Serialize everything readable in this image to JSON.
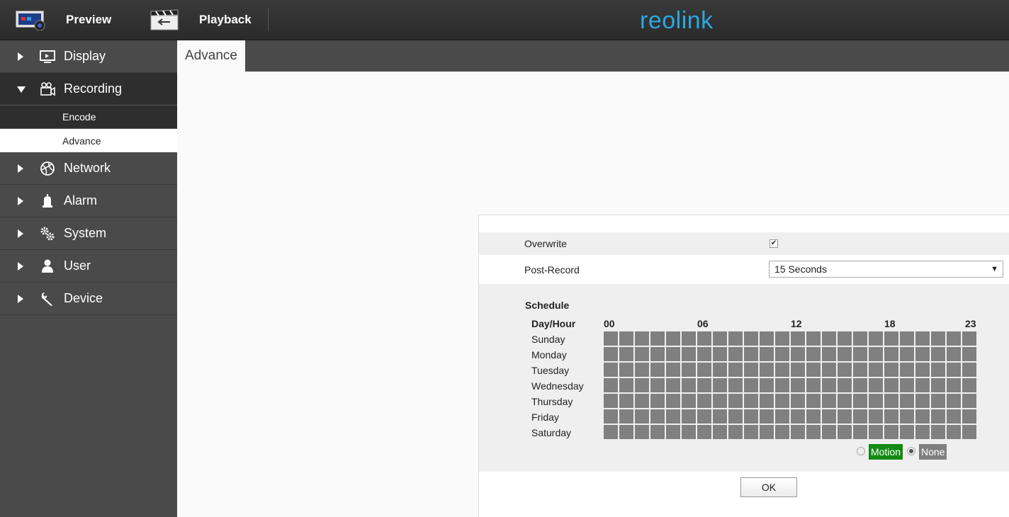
{
  "topbar": {
    "preview_label": "Preview",
    "playback_label": "Playback",
    "logo_text": "reolink",
    "logo_color": "#2aa8e0"
  },
  "sidebar": {
    "items": [
      {
        "label": "Display",
        "icon": "monitor-icon",
        "expanded": false
      },
      {
        "label": "Recording",
        "icon": "camera-icon",
        "expanded": true
      },
      {
        "label": "Network",
        "icon": "globe-icon",
        "expanded": false
      },
      {
        "label": "Alarm",
        "icon": "alarm-bell-icon",
        "expanded": false
      },
      {
        "label": "System",
        "icon": "gears-icon",
        "expanded": false
      },
      {
        "label": "User",
        "icon": "user-icon",
        "expanded": false
      },
      {
        "label": "Device",
        "icon": "wrench-icon",
        "expanded": false
      }
    ],
    "recording_sub": [
      {
        "label": "Encode"
      },
      {
        "label": "Advance",
        "selected": true
      }
    ]
  },
  "tab": {
    "label": "Advance"
  },
  "form": {
    "overwrite_label": "Overwrite",
    "overwrite_checked": true,
    "post_record_label": "Post-Record",
    "post_record_value": "15 Seconds"
  },
  "schedule": {
    "title": "Schedule",
    "day_hour_label": "Day/Hour",
    "hour_labels": [
      "00",
      "06",
      "12",
      "18",
      "23"
    ],
    "days": [
      "Sunday",
      "Monday",
      "Tuesday",
      "Wednesday",
      "Thursday",
      "Friday",
      "Saturday"
    ],
    "hours": 24,
    "cell_state": "none",
    "cell_color": "#808080"
  },
  "legend": {
    "motion_label": "Motion",
    "motion_color": "#138a13",
    "none_label": "None",
    "none_color": "#808080",
    "selected": "none"
  },
  "ok_label": "OK"
}
